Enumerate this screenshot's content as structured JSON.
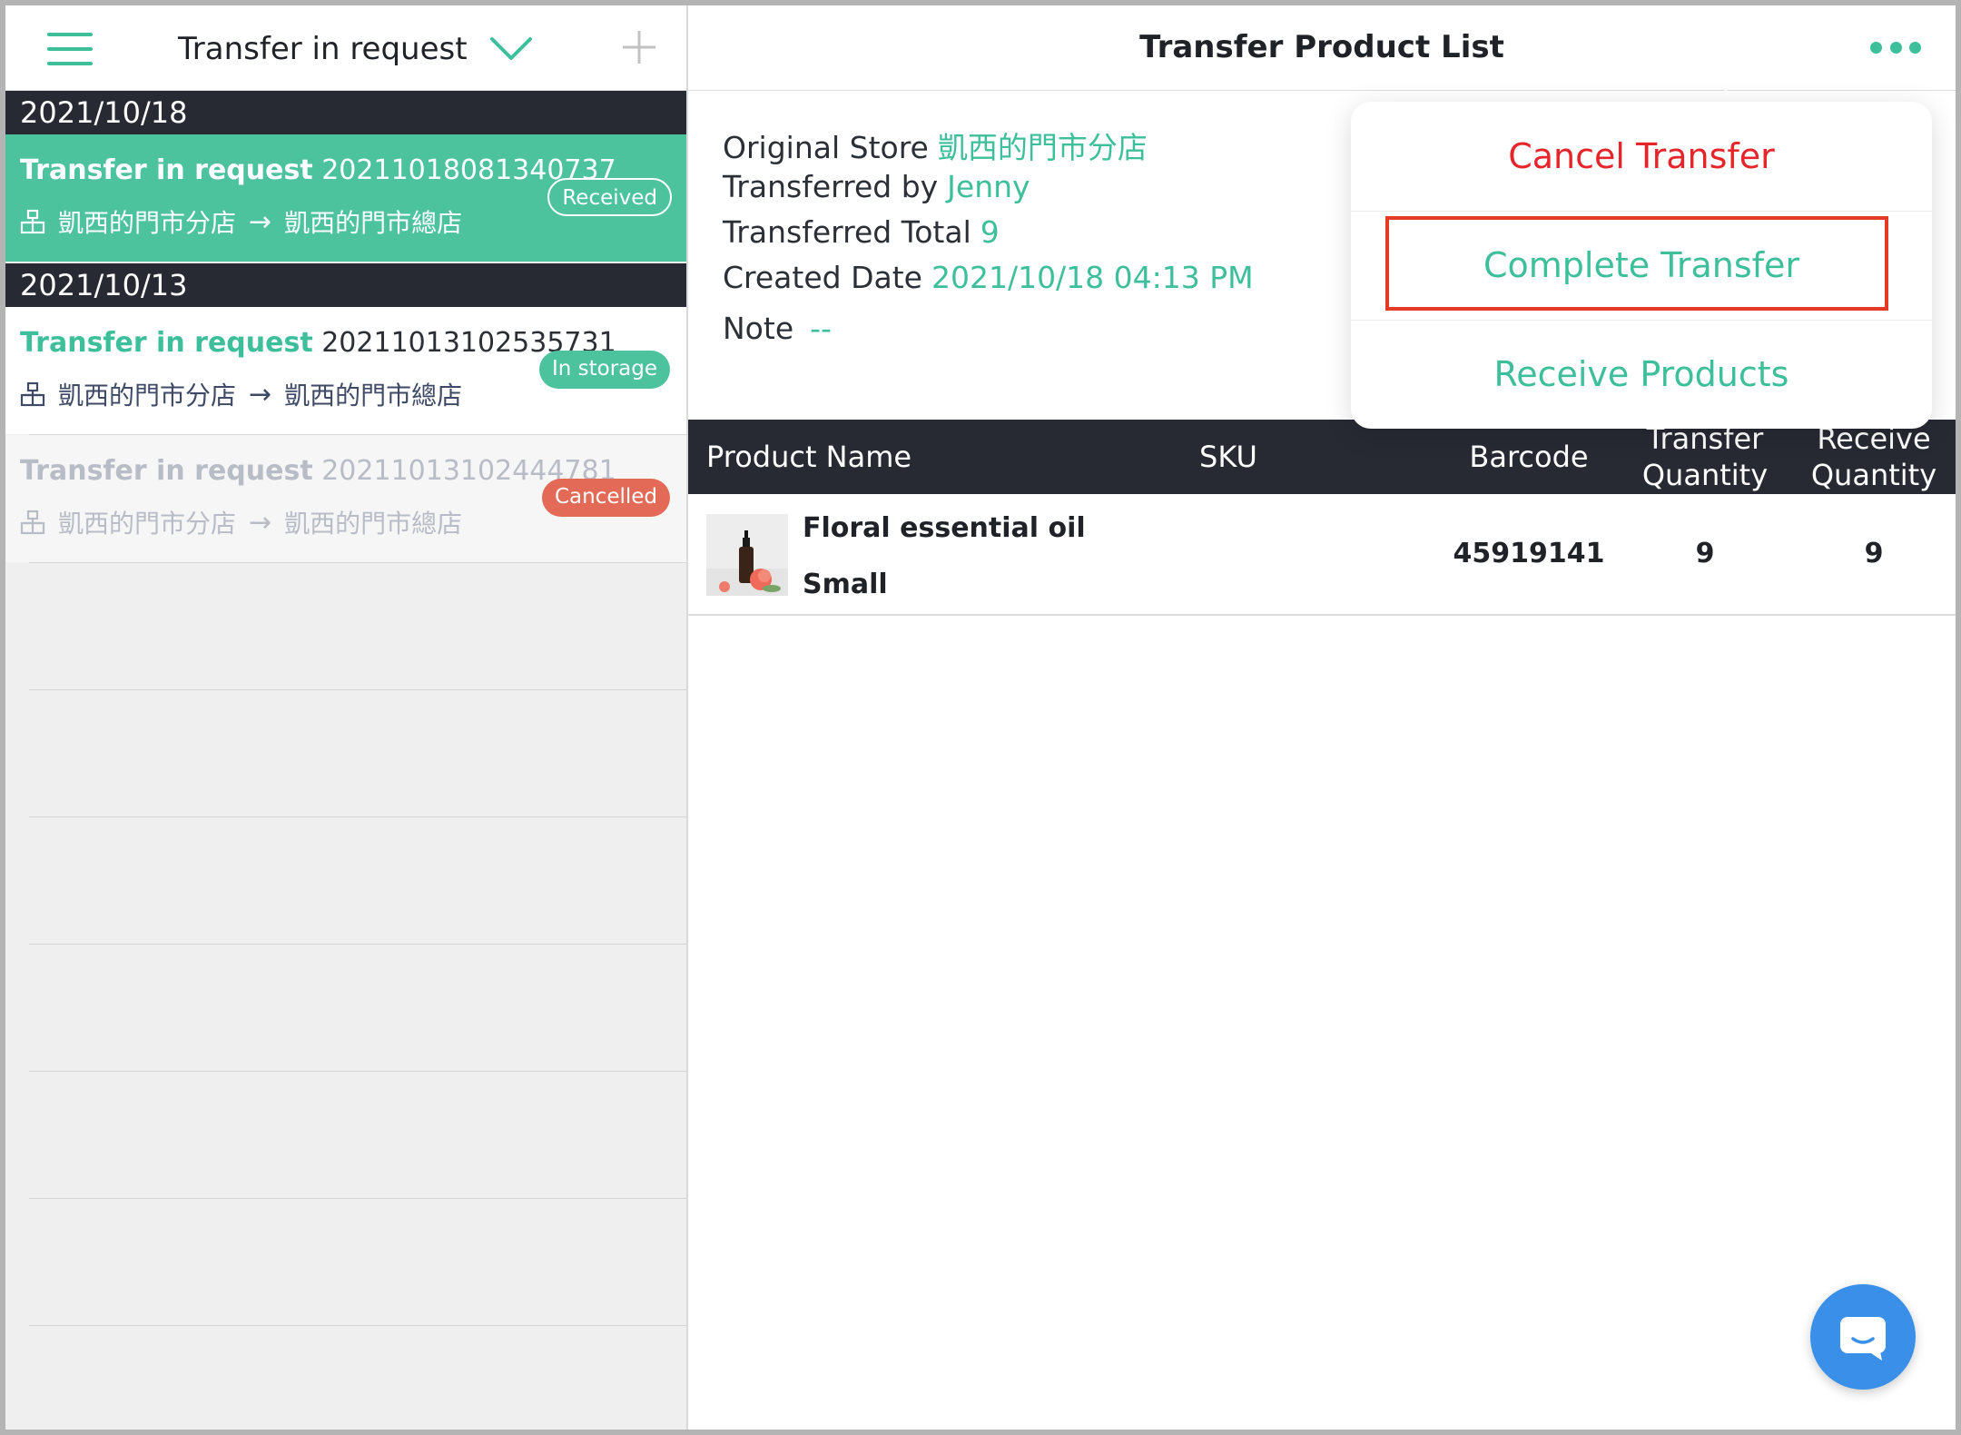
{
  "left_pane": {
    "filter_label": "Transfer in request",
    "groups": [
      {
        "date": "2021/10/18",
        "items": [
          {
            "type": "Transfer in request",
            "number": "20211018081340737",
            "from": "凱西的門市分店",
            "arrow": "→",
            "to": "凱西的門市總店",
            "status": "Received",
            "state": "active"
          }
        ]
      },
      {
        "date": "2021/10/13",
        "items": [
          {
            "type": "Transfer in request",
            "number": "20211013102535731",
            "from": "凱西的門市分店",
            "arrow": "→",
            "to": "凱西的門市總店",
            "status": "In storage",
            "state": "normal"
          },
          {
            "type": "Transfer in request",
            "number": "20211013102444781",
            "from": "凱西的門市分店",
            "arrow": "→",
            "to": "凱西的門市總店",
            "status": "Cancelled",
            "state": "cancelled"
          }
        ]
      }
    ]
  },
  "right_pane": {
    "title": "Transfer Product List",
    "info": {
      "original_store_label": "Original Store",
      "original_store_value": "凱西的門市分店",
      "transferred_by_label": "Transferred by",
      "transferred_by_value": "Jenny",
      "total_label": "Transferred Total",
      "total_value": "9",
      "created_label": "Created Date",
      "created_value": "2021/10/18 04:13 PM",
      "note_label": "Note",
      "note_value": "--"
    },
    "table": {
      "columns": {
        "product_name": "Product Name",
        "sku": "SKU",
        "barcode": "Barcode",
        "transfer_qty_1": "Transfer",
        "transfer_qty_2": "Quantity",
        "receive_qty_1": "Receive",
        "receive_qty_2": "Quantity"
      },
      "rows": [
        {
          "name": "Floral essential oil",
          "variant": "Small",
          "sku": "",
          "barcode": "45919141",
          "transfer_qty": "9",
          "receive_qty": "9"
        }
      ]
    }
  },
  "menu": {
    "cancel_transfer": "Cancel Transfer",
    "complete_transfer": "Complete Transfer",
    "receive_products": "Receive Products"
  },
  "colors": {
    "accent": "#3dbf9b",
    "dark_header": "#272a33",
    "danger": "#e5252a",
    "highlight": "#e53a25",
    "chat": "#3a8fe8"
  }
}
